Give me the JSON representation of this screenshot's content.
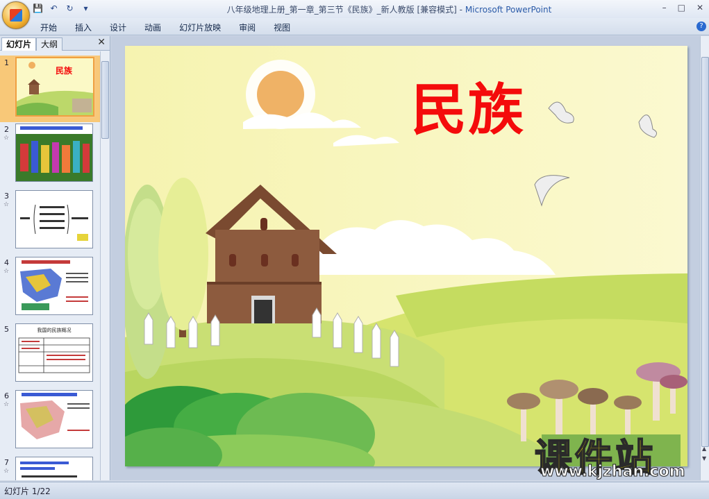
{
  "window": {
    "title": "八年级地理上册_第一章_第三节《民族》_新人教版 [兼容模式]",
    "separator": " - ",
    "app_name": "Microsoft PowerPoint",
    "controls": [
      "–",
      "□",
      "✕"
    ]
  },
  "qat": {
    "save": "💾",
    "undo": "↶",
    "redo": "↻",
    "more": "▾"
  },
  "ribbon": {
    "tabs": [
      "开始",
      "插入",
      "设计",
      "动画",
      "幻灯片放映",
      "审阅",
      "视图"
    ],
    "help": "?"
  },
  "panel": {
    "tab_slides": "幻灯片",
    "tab_outline": "大纲",
    "close": "✕",
    "slides": [
      {
        "num": "1"
      },
      {
        "num": "2",
        "star": "☆"
      },
      {
        "num": "3",
        "star": "☆"
      },
      {
        "num": "4",
        "star": "☆"
      },
      {
        "num": "5"
      },
      {
        "num": "6",
        "star": "☆"
      },
      {
        "num": "7",
        "star": "☆"
      }
    ],
    "thumb1_title": "民族",
    "thumb5_title": "我国的民族概况"
  },
  "slide": {
    "title": "民族"
  },
  "watermark": {
    "cn": "课件站",
    "url": "www.kjzhan.com"
  },
  "status": {
    "text": "幻灯片 1/22"
  }
}
